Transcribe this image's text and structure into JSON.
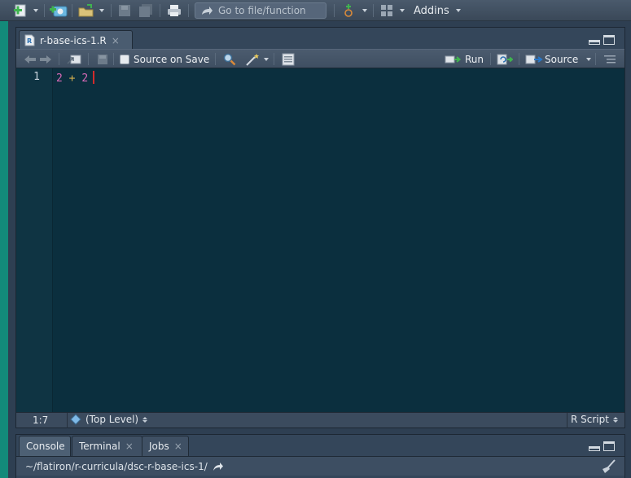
{
  "main_toolbar": {
    "goto_placeholder": "Go to file/function",
    "addins_label": "Addins"
  },
  "editor": {
    "tab": {
      "filename": "r-base-ics-1.R",
      "close": "×"
    },
    "toolbar": {
      "source_on_save_label": "Source on Save",
      "source_on_save_checked": false,
      "run_label": "Run",
      "source_label": "Source"
    },
    "code": {
      "line_numbers": [
        "1"
      ],
      "line1": {
        "left": "2",
        "op": "+",
        "right": "2"
      }
    },
    "status": {
      "cursor_position": "1:7",
      "scope": "(Top Level)",
      "file_type": "R Script"
    }
  },
  "console": {
    "tabs": [
      {
        "label": "Console",
        "closable": false
      },
      {
        "label": "Terminal",
        "close": "×"
      },
      {
        "label": "Jobs",
        "close": "×"
      }
    ],
    "working_dir": "~/flatiron/r-curricula/dsc-r-base-ics-1/"
  },
  "colors": {
    "toolbar_bg": "#3f4e5f",
    "editor_bg": "#0b2f3e",
    "gutter_bg": "#0f3443",
    "number_token": "#d86ab6",
    "operator_token": "#d7b24f",
    "cursor": "#d12b2b",
    "run_icon_green": "#3fb34f",
    "sidebar_teal": "#138a7a"
  },
  "icons": [
    "new-file-icon",
    "new-project-icon",
    "open-file-icon",
    "save-icon",
    "save-all-icon",
    "print-icon",
    "goto-arrow-icon",
    "vcs-icon",
    "grid-layout-icon",
    "back-arrow-icon",
    "forward-arrow-icon",
    "show-in-window-icon",
    "search-icon",
    "magic-wand-icon",
    "compile-report-icon",
    "run-icon",
    "rerun-icon",
    "source-icon",
    "outline-icon",
    "minimize-pane-icon",
    "maximize-pane-icon",
    "r-file-icon",
    "code-tool-icon",
    "navigate-dir-icon",
    "clear-console-broom-icon"
  ]
}
